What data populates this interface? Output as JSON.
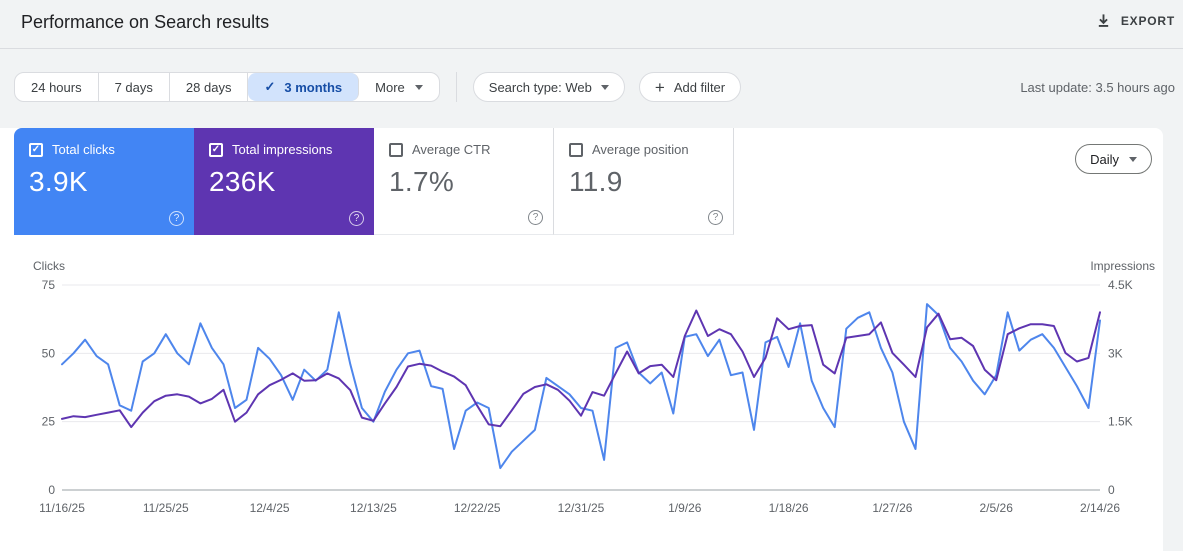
{
  "header": {
    "title": "Performance on Search results",
    "export_label": "EXPORT"
  },
  "filters": {
    "date_ranges": [
      {
        "label": "24 hours",
        "selected": false
      },
      {
        "label": "7 days",
        "selected": false
      },
      {
        "label": "28 days",
        "selected": false
      },
      {
        "label": "3 months",
        "selected": true
      },
      {
        "label": "More",
        "selected": false
      }
    ],
    "search_type_label": "Search type: Web",
    "add_filter_label": "Add filter",
    "last_update": "Last update: 3.5 hours ago"
  },
  "metrics": {
    "cards": [
      {
        "label": "Total clicks",
        "value": "3.9K",
        "checked": true,
        "color": "#4285f4"
      },
      {
        "label": "Total impressions",
        "value": "236K",
        "checked": true,
        "color": "#5e35b1"
      },
      {
        "label": "Average CTR",
        "value": "1.7%",
        "checked": false,
        "color": "#ffffff"
      },
      {
        "label": "Average position",
        "value": "11.9",
        "checked": false,
        "color": "#ffffff"
      }
    ],
    "granularity": "Daily"
  },
  "icons": {
    "check": "✓",
    "plus": "+",
    "help": "?",
    "caret": "triangle-down",
    "export": "download-arrow"
  },
  "colors": {
    "clicks_blue": "#4285f4",
    "impressions_purple": "#5e35b1",
    "clicks_line": "#4e86ec",
    "impressions_line": "#5e35b1",
    "selected_range_bg": "#d2e3fc",
    "selected_range_text": "#174ea6",
    "gridline": "#e9eaed",
    "axis_line": "#9aa0a6"
  },
  "chart_data": {
    "type": "line",
    "title": "",
    "grid": true,
    "legend_position": "none",
    "x_tick_labels": [
      "11/16/25",
      "11/25/25",
      "12/4/25",
      "12/13/25",
      "12/22/25",
      "12/31/25",
      "1/9/26",
      "1/18/26",
      "1/27/26",
      "2/5/26",
      "2/14/26"
    ],
    "x_tick_indices": [
      0,
      9,
      18,
      27,
      36,
      45,
      54,
      63,
      72,
      81,
      90
    ],
    "left_axis": {
      "label": "Clicks",
      "range": [
        0,
        75
      ],
      "ticks": [
        0,
        25,
        50,
        75
      ],
      "tick_labels": [
        "0",
        "25",
        "50",
        "75"
      ]
    },
    "right_axis": {
      "label": "Impressions",
      "range": [
        0,
        4500
      ],
      "ticks": [
        0,
        1500,
        3000,
        4500
      ],
      "tick_labels": [
        "0",
        "1.5K",
        "3K",
        "4.5K"
      ]
    },
    "series": [
      {
        "name": "Clicks",
        "axis": "left",
        "color": "#4e86ec",
        "values": [
          46,
          50,
          55,
          49,
          46,
          31,
          29,
          47,
          50,
          57,
          50,
          46,
          61,
          52,
          46,
          30,
          33,
          52,
          48,
          42,
          33,
          44,
          40,
          44,
          65,
          46,
          30,
          25,
          36,
          44,
          50,
          51,
          38,
          37,
          15,
          29,
          32,
          30,
          8,
          14,
          18,
          22,
          41,
          38,
          35,
          30,
          29,
          11,
          52,
          54,
          43,
          39,
          43,
          28,
          56,
          57,
          49,
          55,
          42,
          43,
          22,
          54,
          56,
          45,
          61,
          40,
          30,
          23,
          59,
          63,
          65,
          52,
          43,
          25,
          15,
          68,
          64,
          52,
          47,
          40,
          35,
          42,
          65,
          51,
          55,
          57,
          52,
          45,
          38,
          30,
          62
        ]
      },
      {
        "name": "Impressions",
        "axis": "right",
        "color": "#5e35b1",
        "values": [
          1560,
          1620,
          1600,
          1650,
          1700,
          1750,
          1380,
          1700,
          1950,
          2070,
          2100,
          2050,
          1900,
          2000,
          2200,
          1500,
          1700,
          2100,
          2300,
          2420,
          2560,
          2400,
          2410,
          2560,
          2450,
          2190,
          1590,
          1520,
          1900,
          2260,
          2710,
          2770,
          2730,
          2600,
          2490,
          2300,
          1850,
          1440,
          1400,
          1750,
          2110,
          2260,
          2320,
          2200,
          1960,
          1630,
          2150,
          2070,
          2560,
          3040,
          2560,
          2720,
          2750,
          2480,
          3380,
          3940,
          3380,
          3530,
          3420,
          3040,
          2480,
          2900,
          3770,
          3530,
          3600,
          3620,
          2750,
          2560,
          3340,
          3380,
          3420,
          3680,
          3010,
          2750,
          2480,
          3570,
          3870,
          3310,
          3340,
          3160,
          2640,
          2410,
          3420,
          3550,
          3640,
          3640,
          3600,
          3010,
          2820,
          2900,
          3900
        ]
      }
    ]
  }
}
